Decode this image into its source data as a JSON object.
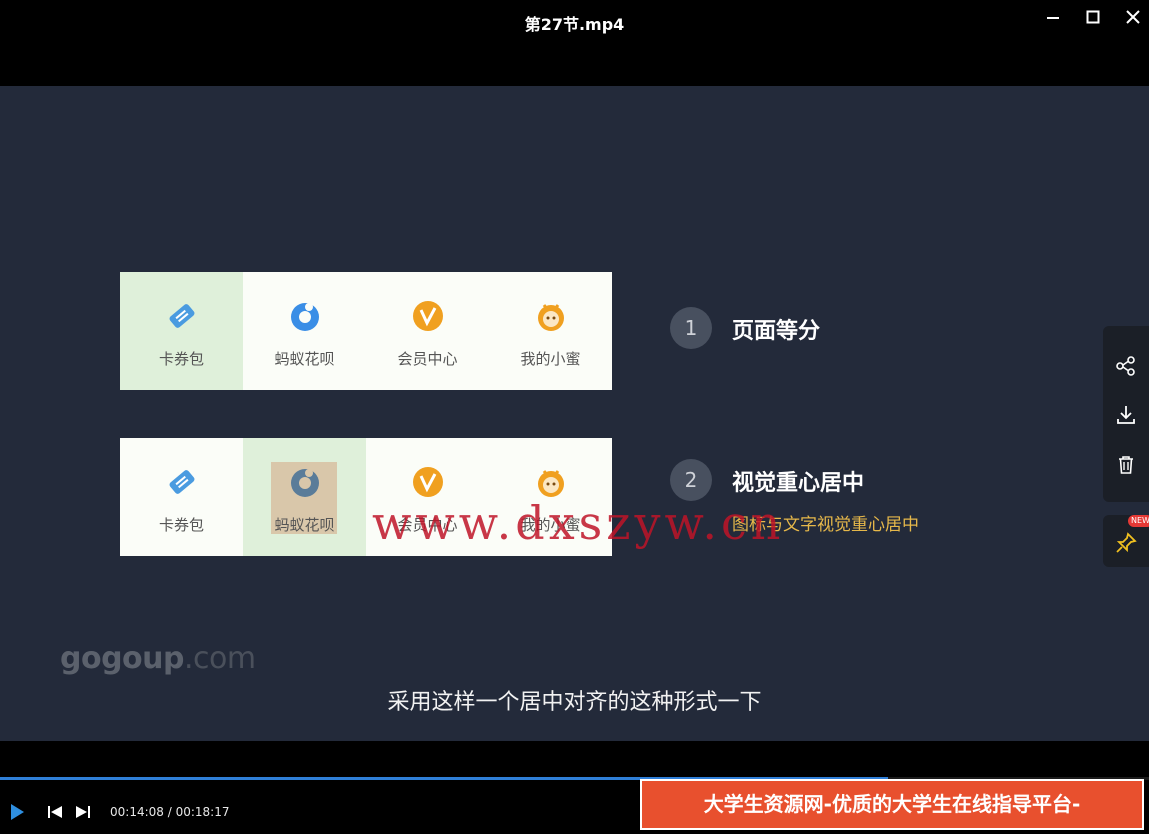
{
  "window": {
    "title": "第27节.mp4",
    "minimize_label": "—",
    "maximize_label": "☐",
    "close_label": "✕"
  },
  "slide": {
    "row1": [
      {
        "label": "卡券包",
        "icon": "ticket-icon"
      },
      {
        "label": "蚂蚁花呗",
        "icon": "huabei-icon"
      },
      {
        "label": "会员中心",
        "icon": "vip-icon"
      },
      {
        "label": "我的小蜜",
        "icon": "bee-icon"
      }
    ],
    "row2": [
      {
        "label": "卡券包",
        "icon": "ticket-icon"
      },
      {
        "label": "蚂蚁花呗",
        "icon": "huabei-icon"
      },
      {
        "label": "会员中心",
        "icon": "vip-icon"
      },
      {
        "label": "我的小蜜",
        "icon": "bee-icon"
      }
    ],
    "point1": {
      "number": "1",
      "title": "页面等分"
    },
    "point2": {
      "number": "2",
      "title": "视觉重心居中",
      "subtitle": "图标与文字视觉重心居中"
    },
    "colors": {
      "background": "#232a3a",
      "highlight_green": "#dff0da",
      "focus_box": "#d9c7aa",
      "accent_yellow": "#e6b84a"
    }
  },
  "overlay": {
    "gogoup_main": "gogoup",
    "gogoup_suffix": ".com",
    "watermark": "www.dxszyw.cn",
    "subtitle": "采用这样一个居中对齐的这种形式一下"
  },
  "side_panel": {
    "buttons": [
      "share-icon",
      "download-icon",
      "trash-icon"
    ],
    "pin_icon": "pin-icon",
    "new_badge": "NEW"
  },
  "player": {
    "current_time": "00:14:08",
    "separator": " / ",
    "total_time": "00:18:17",
    "progress": 0.773,
    "progress_color": "#2f7fd8"
  },
  "banner": {
    "text": "大学生资源网-优质的大学生在线指导平台-www.dxszyw.cn"
  }
}
